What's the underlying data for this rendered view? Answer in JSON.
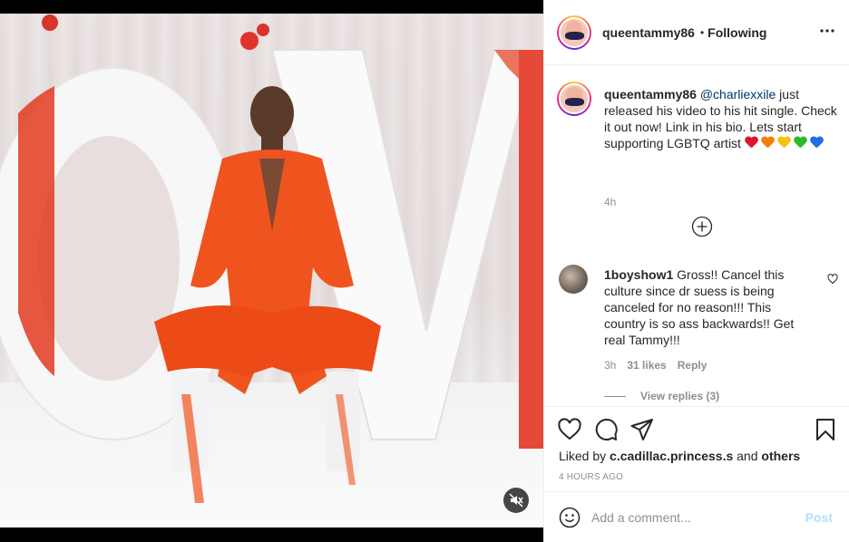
{
  "post": {
    "username": "queentammy86",
    "separator": "•",
    "follow_label": "Following"
  },
  "caption": {
    "username": "queentammy86",
    "mention": "@charliexxile",
    "text": " just released his video to his hit single. Check it out now! Link in his bio. Lets start supporting LGBTQ artist ",
    "time": "4h"
  },
  "comment": {
    "username": "1boyshow1",
    "text": " Gross!! Cancel this culture since dr suess is being canceled for no reason!!! This country is so ass backwards!! Get real Tammy!!!",
    "time": "3h",
    "likes": "31 likes",
    "reply_label": "Reply",
    "view_replies": "View replies (3)"
  },
  "actions": {
    "liked_by_prefix": "Liked by ",
    "liked_by_user": "c.cadillac.princess.s",
    "liked_by_and": " and ",
    "liked_by_others": "others",
    "time_ago": "4 HOURS AGO"
  },
  "add_comment": {
    "placeholder": "Add a comment...",
    "post_label": "Post"
  },
  "colors": {
    "text": "#262626",
    "secondary": "#8e8e8e",
    "mention": "#00376b",
    "post_disabled": "#b2dffc",
    "outfit": "#f0541e"
  }
}
